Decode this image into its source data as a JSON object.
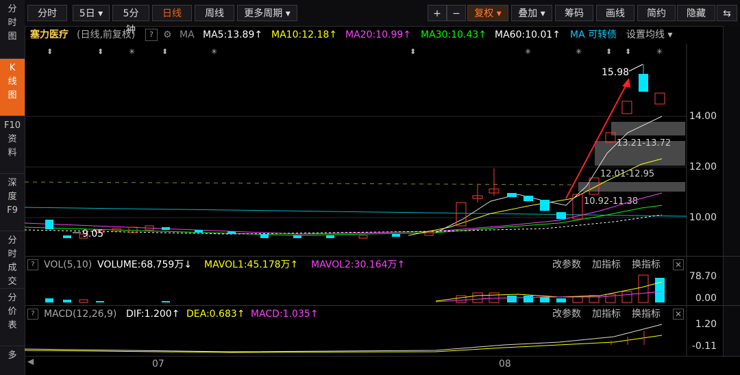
{
  "sidebar": {
    "items": [
      {
        "label": "分\n时\n图"
      },
      {
        "label": "K\n线\n图"
      },
      {
        "label": "F10\n资\n料"
      },
      {
        "label": "深\n度\nF9"
      },
      {
        "label": "分\n时\n成\n交"
      },
      {
        "label": "分\n价\n表"
      },
      {
        "label": "多"
      }
    ]
  },
  "toolbar": {
    "fenshi": "分时",
    "wuri": "5日 ▾",
    "wufenzhong": "5分钟",
    "rixian": "日线",
    "zhouxian": "周线",
    "more_periods": "更多周期 ▾",
    "zoom_in": "+",
    "zoom_out": "−",
    "fuquan": "复权 ▾",
    "diejia": "叠加 ▾",
    "chouma": "筹码",
    "huaxian": "画线",
    "jianling": "简约",
    "hide": "隐藏",
    "expand": "⇆"
  },
  "info": {
    "stock": "塞力医疗",
    "mode": "(日线,前复权)",
    "help": "?",
    "ma_label": "MA",
    "ma5": "MA5:13.89↑",
    "ma10": "MA10:12.18↑",
    "ma20": "MA20:10.99↑",
    "ma30": "MA30:10.43↑",
    "ma60": "MA60:10.01↑",
    "ma_conv": "MA 可转债",
    "settings": "设置均线 ▾"
  },
  "price_labels": {
    "y14": "14.00",
    "y12": "12.00",
    "y10": "10.00"
  },
  "annotations": {
    "high": "15.98",
    "low": "9.05",
    "zone1": "13.21-13.72",
    "zone2": "12.01-12.95",
    "zone3": "10.92-11.38"
  },
  "vol_panel": {
    "title": "VOL(5,10)",
    "volume": "VOLUME:68.759万↓",
    "mavol1": "MAVOL1:45.178万↑",
    "mavol2": "MAVOL2:30.164万↑",
    "params": "改参数",
    "add_indicator": "加指标",
    "switch_indicator": "换指标",
    "close": "✕",
    "ymax": "78.70",
    "ymin": "0.00"
  },
  "macd_panel": {
    "title": "MACD(12,26,9)",
    "dif": "DIF:1.200↑",
    "dea": "DEA:0.683↑",
    "macd": "MACD:1.035↑",
    "params": "改参数",
    "add_indicator": "加指标",
    "switch_indicator": "换指标",
    "close": "✕",
    "ymax": "1.20",
    "ymin": "-0.11"
  },
  "x_axis": {
    "m07": "07",
    "m08": "08"
  },
  "colors": {
    "up": "#ff3b3b",
    "down": "#00e5ff",
    "ma5": "#ffffff",
    "ma10": "#ffff00",
    "ma20": "#ff40ff",
    "ma30": "#00ff00",
    "ma60": "#ffffff",
    "accent": "#e8641a"
  }
}
